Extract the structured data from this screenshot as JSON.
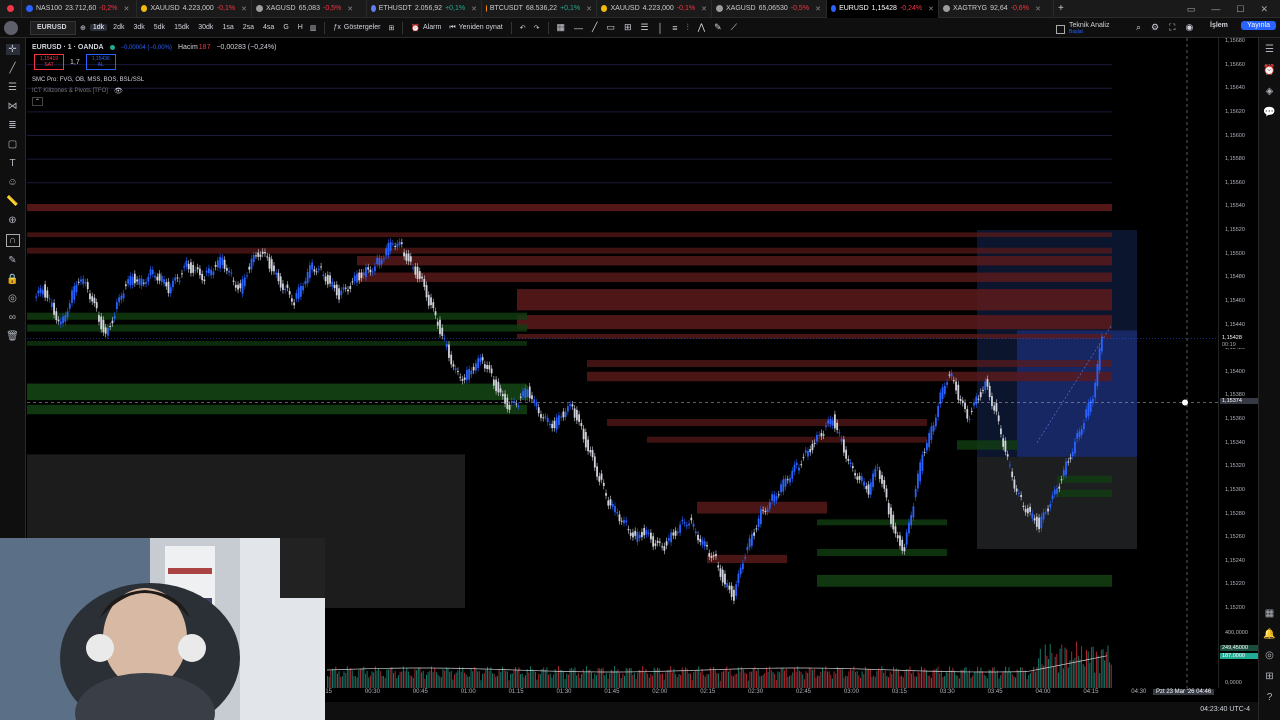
{
  "tabs": [
    {
      "name": "NAS100",
      "price": "23.712,60",
      "chg": "-0,2%",
      "color": "#2962ff",
      "up": false
    },
    {
      "name": "XAUUSD",
      "price": "4.223,000",
      "chg": "-0,1%",
      "color": "#f0b90b",
      "up": false
    },
    {
      "name": "XAGUSD",
      "price": "65,083",
      "chg": "-0,5%",
      "color": "#9e9e9e",
      "up": false
    },
    {
      "name": "ETHUSDT",
      "price": "2.056,92",
      "chg": "+0,1%",
      "color": "#627eea",
      "up": true
    },
    {
      "name": "BTCUSDT",
      "price": "68.536,22",
      "chg": "+0,1%",
      "color": "#f7931a",
      "up": true
    },
    {
      "name": "XAUUSD",
      "price": "4.223,000",
      "chg": "-0,1%",
      "color": "#f0b90b",
      "up": false
    },
    {
      "name": "XAGUSD",
      "price": "65,06530",
      "chg": "-0,5%",
      "color": "#9e9e9e",
      "up": false
    },
    {
      "name": "EURUSD",
      "price": "1,15428",
      "chg": "-0,24%",
      "color": "#2962ff",
      "up": false,
      "active": true
    },
    {
      "name": "XAGTRYG",
      "price": "92,64",
      "chg": "-0,6%",
      "color": "#9e9e9e",
      "up": false
    }
  ],
  "toolbar": {
    "symbol": "EURUSD",
    "timeframes": [
      "1dk",
      "2dk",
      "3dk",
      "5dk",
      "15dk",
      "30dk",
      "1sa",
      "2sa",
      "4sa",
      "G",
      "H"
    ],
    "active_tf": "1dk",
    "indicators": "Göstergeler",
    "alarm": "Alarm",
    "replay": "Yeniden oynat",
    "analysis": "Teknik Analiz",
    "analysis_sub": "Başlat",
    "trade": "İşlem",
    "publish": "Yayınla"
  },
  "legend": {
    "title": "EURUSD · 1 · OANDA",
    "change": "−0,00004 (−0,00%)",
    "volume_label": "Hacim",
    "volume_value": "187",
    "volume_change": "−0,00283 (−0,24%)",
    "sell_price": "1,15419",
    "sell_label": "SAT",
    "spread": "1,7",
    "buy_price": "1,15436",
    "buy_label": "AL",
    "indicator1": "SMC Pro: FVG, OB, MSS, BOS, BSL/SSL",
    "indicator2": "ICT Killzones & Pivots [TFO]"
  },
  "price_axis": [
    "1,15680",
    "1,15660",
    "1,15640",
    "1,15620",
    "1,15600",
    "1,15580",
    "1,15560",
    "1,15540",
    "1,15520",
    "1,15500",
    "1,15480",
    "1,15460",
    "1,15440",
    "1,15420",
    "1,15400",
    "1,15380",
    "1,15360",
    "1,15340",
    "1,15320",
    "1,15300",
    "1,15280",
    "1,15260",
    "1,15240",
    "1,15220",
    "1,15200"
  ],
  "current_price": "1,15428",
  "countdown": "00:19",
  "crosshair_price": "1,15374",
  "volume_axis": [
    "400,0000",
    "0,0000"
  ],
  "volume_labels": [
    "249,45000",
    "187,0000"
  ],
  "time_axis": [
    "00:15",
    "00:30",
    "00:45",
    "01:00",
    "01:15",
    "01:30",
    "01:45",
    "02:00",
    "02:15",
    "02:30",
    "02:45",
    "03:00",
    "03:15",
    "03:30",
    "03:45",
    "04:00",
    "04:15",
    "04:30"
  ],
  "crosshair_time": "Pzt 23 Mar '26  04:46",
  "clock": "04:23:40 UTC-4",
  "colors": {
    "up": "#2962ff",
    "down": "#d1d4dc",
    "bear_zone": "#5c1a1a",
    "bull_zone": "#123d12",
    "accent": "#2962ff"
  }
}
